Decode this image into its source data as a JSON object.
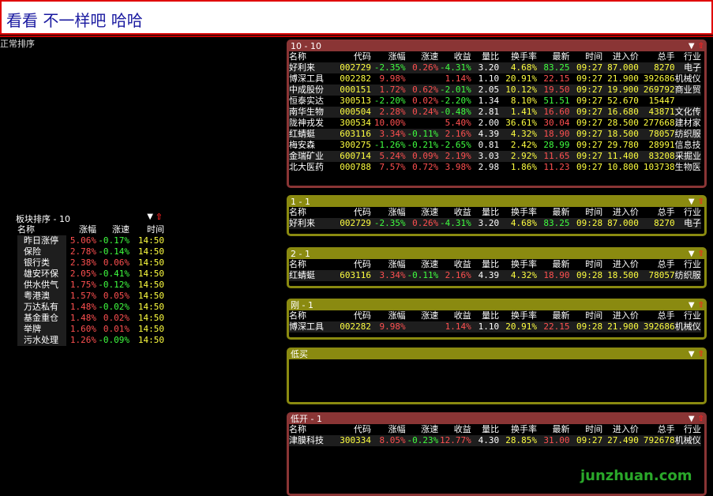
{
  "banner": "看看 不一样吧 哈哈",
  "mode_label": "正常排序",
  "sector": {
    "title": "板块排序 - 10",
    "headers": [
      "名称",
      "涨幅",
      "涨速",
      "时间"
    ],
    "rows": [
      [
        "昨日涨停",
        "5.06%",
        "-0.17%",
        "14:50"
      ],
      [
        "保险",
        "2.78%",
        "-0.14%",
        "14:50"
      ],
      [
        "银行类",
        "2.38%",
        "0.06%",
        "14:50"
      ],
      [
        "雄安环保",
        "2.05%",
        "-0.41%",
        "14:50"
      ],
      [
        "供水供气",
        "1.75%",
        "-0.12%",
        "14:50"
      ],
      [
        "粤港澳",
        "1.57%",
        "0.05%",
        "14:50"
      ],
      [
        "万达私有",
        "1.48%",
        "-0.02%",
        "14:50"
      ],
      [
        "基金重仓",
        "1.48%",
        "0.02%",
        "14:50"
      ],
      [
        "举牌",
        "1.60%",
        "0.01%",
        "14:50"
      ],
      [
        "污水处理",
        "1.26%",
        "-0.09%",
        "14:50"
      ]
    ]
  },
  "columns": [
    "名称",
    "代码",
    "涨幅",
    "涨速",
    "收益",
    "量比",
    "换手率",
    "最新",
    "时间",
    "进入价",
    "总手",
    "行业"
  ],
  "panels": [
    {
      "title": "10 - 10",
      "rows": [
        [
          "好利来",
          "002729",
          "-2.35%",
          "0.26%",
          "-4.31%",
          "3.20",
          "4.68%",
          "83.25",
          "09:27",
          "87.000",
          "8270",
          "电子"
        ],
        [
          "博深工具",
          "002282",
          "9.98%",
          "",
          "1.14%",
          "1.10",
          "20.91%",
          "22.15",
          "09:27",
          "21.900",
          "392686",
          "机械仪表"
        ],
        [
          "中成股份",
          "000151",
          "1.72%",
          "0.62%",
          "-2.01%",
          "2.05",
          "10.12%",
          "19.50",
          "09:27",
          "19.900",
          "269792",
          "商业贸易"
        ],
        [
          "恒泰实达",
          "300513",
          "-2.20%",
          "0.02%",
          "-2.20%",
          "1.34",
          "8.10%",
          "51.51",
          "09:27",
          "52.670",
          "15447",
          ""
        ],
        [
          "南华生物",
          "000504",
          "2.28%",
          "0.24%",
          "-0.48%",
          "2.81",
          "1.41%",
          "16.60",
          "09:27",
          "16.680",
          "43871",
          "文化传播"
        ],
        [
          "陇神戎发",
          "300534",
          "10.00%",
          "",
          "5.40%",
          "2.00",
          "36.61%",
          "30.04",
          "09:27",
          "28.500",
          "277668",
          "建材家具"
        ],
        [
          "红蜻蜓",
          "603116",
          "3.34%",
          "-0.11%",
          "2.16%",
          "4.39",
          "4.32%",
          "18.90",
          "09:27",
          "18.500",
          "78057",
          "纺织服装"
        ],
        [
          "梅安森",
          "300275",
          "-1.26%",
          "-0.21%",
          "-2.65%",
          "0.81",
          "2.42%",
          "28.99",
          "09:27",
          "29.780",
          "28991",
          "信息技术"
        ],
        [
          "金瑞矿业",
          "600714",
          "5.24%",
          "0.09%",
          "2.19%",
          "3.03",
          "2.92%",
          "11.65",
          "09:27",
          "11.400",
          "83208",
          "采掘业"
        ],
        [
          "北大医药",
          "000788",
          "7.57%",
          "0.72%",
          "3.98%",
          "2.98",
          "1.86%",
          "11.23",
          "09:27",
          "10.800",
          "103738",
          "生物医药"
        ]
      ]
    },
    {
      "title": "1 - 1",
      "rows": [
        [
          "好利来",
          "002729",
          "-2.35%",
          "0.26%",
          "-4.31%",
          "3.20",
          "4.68%",
          "83.25",
          "09:28",
          "87.000",
          "8270",
          "电子"
        ]
      ]
    },
    {
      "title": "2 - 1",
      "rows": [
        [
          "红蜻蜓",
          "603116",
          "3.34%",
          "-0.11%",
          "2.16%",
          "4.39",
          "4.32%",
          "18.90",
          "09:28",
          "18.500",
          "78057",
          "纺织服装"
        ]
      ]
    },
    {
      "title": "刚 - 1",
      "rows": [
        [
          "博深工具",
          "002282",
          "9.98%",
          "",
          "1.14%",
          "1.10",
          "20.91%",
          "22.15",
          "09:28",
          "21.900",
          "392686",
          "机械仪表"
        ]
      ]
    },
    {
      "title": "低买",
      "rows": []
    },
    {
      "title": "低开 - 1",
      "rows": [
        [
          "津膜科技",
          "300334",
          "8.05%",
          "-0.23%",
          "12.77%",
          "4.30",
          "28.85%",
          "31.00",
          "09:27",
          "27.490",
          "792678",
          "机械仪表"
        ]
      ]
    }
  ],
  "panel_controls": {
    "dropdown": "▼",
    "up": "⇧"
  },
  "watermark": "junzhuan.com",
  "colors": {
    "up": "#ff5050",
    "down": "#40ff40",
    "neutral": "#ffff40",
    "red_panel": "#8a3535",
    "olive_panel": "#8a8a10"
  }
}
